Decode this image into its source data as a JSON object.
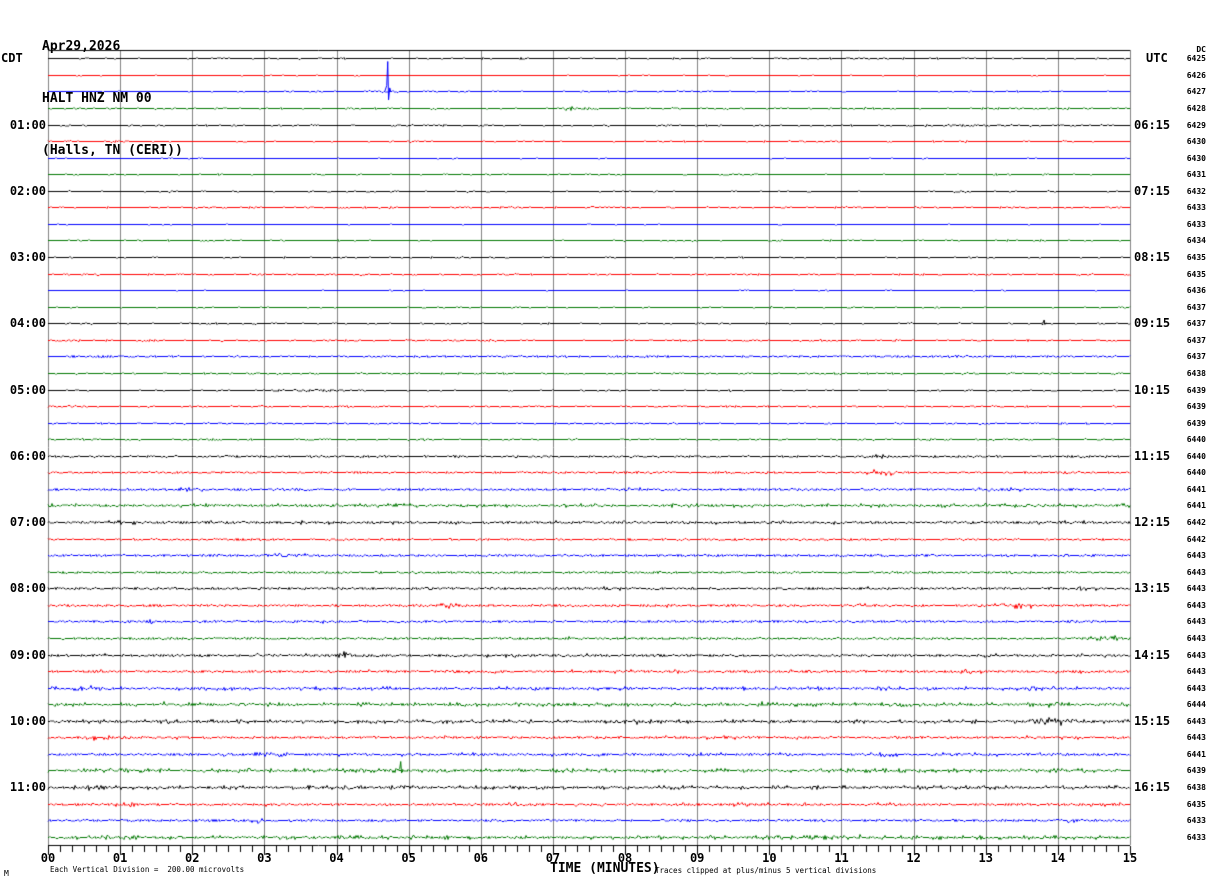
{
  "header": {
    "date": "Apr29,2026",
    "station": "HALT HNZ NM 00",
    "location": "(Halls, TN (CERI))",
    "left_tz": "CDT",
    "right_tz": "UTC",
    "dc_label": "DC"
  },
  "footer": {
    "scale_note": "Each Vertical Division =  200.00 microvolts",
    "axis_label": "TIME (MINUTES)",
    "clip_note": "Traces clipped at plus/minus 5 vertical divisions",
    "corner_glyph": "M"
  },
  "chart_data": {
    "type": "line",
    "title": "HALT HNZ NM 00 (Halls, TN (CERI)) Apr29,2026 helicorder",
    "xlabel": "TIME (MINUTES)",
    "x_range_minutes": [
      0,
      15
    ],
    "x_tick_labels": [
      "00",
      "01",
      "02",
      "03",
      "04",
      "05",
      "06",
      "07",
      "08",
      "09",
      "10",
      "11",
      "12",
      "13",
      "14",
      "15"
    ],
    "minor_ticks_per_minute": 6,
    "grid": true,
    "rows_per_hour": 4,
    "minutes_per_row": 15,
    "colors": {
      "black": "#000000",
      "red": "#ff0000",
      "blue": "#0000ff",
      "green": "#007700",
      "grid": "#808080",
      "frame": "#000000"
    },
    "rows": [
      {
        "cdt": "",
        "utc": "",
        "dc": "6425",
        "color": "black",
        "amp": 0.7,
        "events": [
          [
            11.0,
            11.6,
            1.4
          ]
        ]
      },
      {
        "cdt": "",
        "utc": "",
        "dc": "6426",
        "color": "red",
        "amp": 0.6,
        "events": []
      },
      {
        "cdt": "",
        "utc": "",
        "dc": "6427",
        "color": "blue",
        "amp": 0.7,
        "events": [
          [
            4.3,
            5.1,
            1.8
          ],
          [
            4.68,
            4.74,
            30,
            "spike"
          ]
        ]
      },
      {
        "cdt": "",
        "utc": "",
        "dc": "6428",
        "color": "green",
        "amp": 0.8,
        "events": [
          [
            7.0,
            7.75,
            2.4
          ]
        ]
      },
      {
        "cdt": "01:00",
        "utc": "06:15",
        "dc": "6429",
        "color": "black",
        "amp": 0.8,
        "events": [
          [
            11.2,
            14.9,
            1.2
          ]
        ]
      },
      {
        "cdt": "",
        "utc": "",
        "dc": "6430",
        "color": "red",
        "amp": 0.7,
        "events": [
          [
            0.8,
            1.2,
            1.8
          ]
        ]
      },
      {
        "cdt": "",
        "utc": "",
        "dc": "6430",
        "color": "blue",
        "amp": 0.6,
        "events": []
      },
      {
        "cdt": "",
        "utc": "",
        "dc": "6431",
        "color": "green",
        "amp": 0.7,
        "events": []
      },
      {
        "cdt": "02:00",
        "utc": "07:15",
        "dc": "6432",
        "color": "black",
        "amp": 0.7,
        "events": [
          [
            12.4,
            12.9,
            1.4
          ]
        ]
      },
      {
        "cdt": "",
        "utc": "",
        "dc": "6433",
        "color": "red",
        "amp": 0.8,
        "events": [
          [
            6.2,
            6.6,
            2.2
          ]
        ]
      },
      {
        "cdt": "",
        "utc": "",
        "dc": "6433",
        "color": "blue",
        "amp": 0.6,
        "events": []
      },
      {
        "cdt": "",
        "utc": "",
        "dc": "6434",
        "color": "green",
        "amp": 0.7,
        "events": []
      },
      {
        "cdt": "03:00",
        "utc": "08:15",
        "dc": "6435",
        "color": "black",
        "amp": 0.7,
        "events": []
      },
      {
        "cdt": "",
        "utc": "",
        "dc": "6435",
        "color": "red",
        "amp": 0.8,
        "events": [
          [
            0.15,
            0.6,
            1.8
          ]
        ]
      },
      {
        "cdt": "",
        "utc": "",
        "dc": "6436",
        "color": "blue",
        "amp": 0.6,
        "events": []
      },
      {
        "cdt": "",
        "utc": "",
        "dc": "6437",
        "color": "green",
        "amp": 0.7,
        "events": []
      },
      {
        "cdt": "04:00",
        "utc": "09:15",
        "dc": "6437",
        "color": "black",
        "amp": 0.7,
        "events": [
          [
            13.78,
            13.84,
            3.5,
            "spike"
          ]
        ]
      },
      {
        "cdt": "",
        "utc": "",
        "dc": "6437",
        "color": "red",
        "amp": 0.8,
        "events": [
          [
            0.1,
            0.5,
            1.8
          ]
        ]
      },
      {
        "cdt": "",
        "utc": "",
        "dc": "6437",
        "color": "blue",
        "amp": 1.0,
        "events": [
          [
            0.0,
            1.5,
            1.8
          ]
        ]
      },
      {
        "cdt": "",
        "utc": "",
        "dc": "6438",
        "color": "green",
        "amp": 0.8,
        "events": []
      },
      {
        "cdt": "05:00",
        "utc": "10:15",
        "dc": "6439",
        "color": "black",
        "amp": 0.7,
        "events": [
          [
            2.8,
            4.6,
            1.4
          ]
        ]
      },
      {
        "cdt": "",
        "utc": "",
        "dc": "6439",
        "color": "red",
        "amp": 0.8,
        "events": [
          [
            0.15,
            0.7,
            1.8
          ]
        ]
      },
      {
        "cdt": "",
        "utc": "",
        "dc": "6439",
        "color": "blue",
        "amp": 0.8,
        "events": []
      },
      {
        "cdt": "",
        "utc": "",
        "dc": "6440",
        "color": "green",
        "amp": 0.8,
        "events": [
          [
            0.3,
            0.8,
            1.4
          ]
        ]
      },
      {
        "cdt": "06:00",
        "utc": "11:15",
        "dc": "6440",
        "color": "black",
        "amp": 1.1,
        "events": [
          [
            11.1,
            11.8,
            2.2
          ],
          [
            14.0,
            14.6,
            2.2
          ]
        ]
      },
      {
        "cdt": "",
        "utc": "",
        "dc": "6440",
        "color": "red",
        "amp": 1.0,
        "events": [
          [
            6.3,
            6.7,
            1.8
          ],
          [
            11.2,
            11.9,
            3.2
          ],
          [
            14.0,
            14.6,
            3.0
          ]
        ]
      },
      {
        "cdt": "",
        "utc": "",
        "dc": "6441",
        "color": "blue",
        "amp": 1.5,
        "events": [
          [
            0.7,
            2.8,
            2.2
          ],
          [
            7.0,
            9.0,
            2.2
          ],
          [
            12.5,
            14.5,
            2.4
          ]
        ]
      },
      {
        "cdt": "",
        "utc": "",
        "dc": "6441",
        "color": "green",
        "amp": 1.9,
        "events": [
          [
            1.5,
            2.5,
            2.4
          ],
          [
            4.0,
            5.5,
            2.4
          ],
          [
            9.0,
            10.5,
            2.2
          ]
        ]
      },
      {
        "cdt": "07:00",
        "utc": "12:15",
        "dc": "6442",
        "color": "black",
        "amp": 1.8,
        "events": [
          [
            0.7,
            1.2,
            3.2
          ],
          [
            4.5,
            5.0,
            2.4
          ]
        ]
      },
      {
        "cdt": "",
        "utc": "",
        "dc": "6442",
        "color": "red",
        "amp": 1.1,
        "events": [
          [
            2.5,
            3.0,
            1.8
          ]
        ]
      },
      {
        "cdt": "",
        "utc": "",
        "dc": "6443",
        "color": "blue",
        "amp": 1.4,
        "events": [
          [
            2.5,
            4.4,
            2.2
          ]
        ]
      },
      {
        "cdt": "",
        "utc": "",
        "dc": "6443",
        "color": "green",
        "amp": 1.2,
        "events": []
      },
      {
        "cdt": "08:00",
        "utc": "13:15",
        "dc": "6443",
        "color": "black",
        "amp": 1.5,
        "events": [
          [
            4.2,
            4.9,
            2.2
          ],
          [
            7.4,
            8.2,
            2.4
          ],
          [
            11.0,
            11.7,
            2.2
          ],
          [
            13.9,
            14.8,
            2.4
          ]
        ]
      },
      {
        "cdt": "",
        "utc": "",
        "dc": "6443",
        "color": "red",
        "amp": 1.4,
        "events": [
          [
            5.35,
            5.75,
            3.4
          ],
          [
            8.4,
            8.8,
            2.2
          ],
          [
            11.0,
            11.8,
            2.4
          ],
          [
            13.0,
            13.9,
            3.2
          ]
        ]
      },
      {
        "cdt": "",
        "utc": "",
        "dc": "6443",
        "color": "blue",
        "amp": 1.4,
        "events": [
          [
            1.0,
            1.8,
            2.2
          ],
          [
            3.5,
            4.4,
            2.2
          ]
        ]
      },
      {
        "cdt": "",
        "utc": "",
        "dc": "6443",
        "color": "green",
        "amp": 1.4,
        "events": [
          [
            7.0,
            7.4,
            2.2
          ],
          [
            7.8,
            8.1,
            2.4
          ],
          [
            14.3,
            14.95,
            3.4
          ]
        ]
      },
      {
        "cdt": "09:00",
        "utc": "14:15",
        "dc": "6443",
        "color": "black",
        "amp": 1.7,
        "events": [
          [
            2.6,
            3.3,
            2.4
          ],
          [
            3.95,
            4.25,
            4.5
          ],
          [
            10.4,
            10.6,
            2.6
          ]
        ]
      },
      {
        "cdt": "",
        "utc": "",
        "dc": "6443",
        "color": "red",
        "amp": 1.7,
        "events": [
          [
            8.2,
            9.0,
            2.4
          ],
          [
            12.5,
            12.9,
            2.8
          ],
          [
            13.8,
            14.2,
            3.2
          ]
        ]
      },
      {
        "cdt": "",
        "utc": "",
        "dc": "6443",
        "color": "blue",
        "amp": 1.9,
        "events": [
          [
            0.2,
            0.9,
            3.6
          ],
          [
            1.6,
            3.0,
            2.4
          ],
          [
            4.6,
            5.2,
            2.4
          ],
          [
            8.2,
            8.8,
            2.4
          ],
          [
            11.1,
            12.1,
            2.8
          ],
          [
            13.2,
            14.0,
            2.8
          ]
        ]
      },
      {
        "cdt": "",
        "utc": "",
        "dc": "6444",
        "color": "green",
        "amp": 2.1,
        "events": [
          [
            1.2,
            2.2,
            2.8
          ],
          [
            4.1,
            4.8,
            2.8
          ],
          [
            5.5,
            6.5,
            2.8
          ],
          [
            9.5,
            10.5,
            2.8
          ],
          [
            13.3,
            14.3,
            3.2
          ]
        ]
      },
      {
        "cdt": "10:00",
        "utc": "15:15",
        "dc": "6443",
        "color": "black",
        "amp": 2.1,
        "events": [
          [
            1.3,
            2.0,
            2.8
          ],
          [
            6.5,
            7.1,
            2.8
          ],
          [
            7.7,
            8.5,
            2.8
          ],
          [
            12.5,
            13.1,
            3.2
          ],
          [
            13.5,
            14.4,
            4.5
          ]
        ]
      },
      {
        "cdt": "",
        "utc": "",
        "dc": "6443",
        "color": "red",
        "amp": 1.7,
        "events": [
          [
            0.3,
            1.0,
            3.2
          ],
          [
            5.2,
            6.0,
            2.4
          ],
          [
            9.0,
            9.9,
            2.4
          ],
          [
            13.9,
            14.5,
            2.8
          ]
        ]
      },
      {
        "cdt": "",
        "utc": "",
        "dc": "6441",
        "color": "blue",
        "amp": 1.7,
        "events": [
          [
            2.7,
            3.5,
            2.8
          ],
          [
            11.1,
            12.0,
            2.8
          ]
        ]
      },
      {
        "cdt": "",
        "utc": "",
        "dc": "6439",
        "color": "green",
        "amp": 2.1,
        "events": [
          [
            3.5,
            5.6,
            2.8
          ],
          [
            4.86,
            4.92,
            9,
            "spike"
          ],
          [
            9.5,
            13.0,
            2.8
          ]
        ]
      },
      {
        "cdt": "11:00",
        "utc": "16:15",
        "dc": "6438",
        "color": "black",
        "amp": 2.1,
        "events": [
          [
            0.2,
            1.0,
            2.8
          ],
          [
            4.0,
            4.6,
            2.8
          ],
          [
            7.9,
            9.3,
            2.8
          ],
          [
            10.1,
            11.3,
            2.8
          ],
          [
            12.9,
            13.3,
            2.8
          ]
        ]
      },
      {
        "cdt": "",
        "utc": "",
        "dc": "6435",
        "color": "red",
        "amp": 1.7,
        "events": [
          [
            0.85,
            1.3,
            3.6
          ],
          [
            5.9,
            6.7,
            2.8
          ],
          [
            9.3,
            10.1,
            2.8
          ]
        ]
      },
      {
        "cdt": "",
        "utc": "",
        "dc": "6433",
        "color": "blue",
        "amp": 1.5,
        "events": [
          [
            2.7,
            3.1,
            3.2
          ],
          [
            14.0,
            14.4,
            2.4
          ]
        ]
      },
      {
        "cdt": "",
        "utc": "",
        "dc": "6433",
        "color": "green",
        "amp": 2.1,
        "events": [
          [
            3.5,
            5.2,
            2.8
          ],
          [
            9.0,
            12.5,
            3.0
          ],
          [
            13.8,
            14.4,
            2.8
          ]
        ]
      }
    ]
  }
}
